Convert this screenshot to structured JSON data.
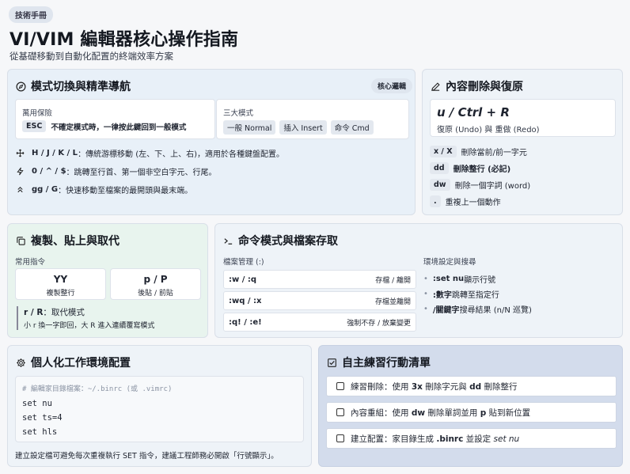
{
  "header": {
    "tag": "技術手冊",
    "title": "VI/VIM 編輯器核心操作指南",
    "subtitle": "從基礎移動到自動化配置的終端效率方案"
  },
  "nav": {
    "title": "模式切換與精準導航",
    "badge": "核心邏輯",
    "safe_label": "萬用保險",
    "safe_key": "ESC",
    "safe_desc": "不確定模式時，一律按此鍵回到一般模式",
    "modes_label": "三大模式",
    "modes": [
      "一般 Normal",
      "插入 Insert",
      "命令 Cmd"
    ],
    "items": [
      {
        "key": "H / J / K / L",
        "desc": "：傳統游標移動 (左、下、上、右)，適用於各種鍵盤配置。"
      },
      {
        "key": "0 / ^ / $",
        "desc": "：跳轉至行首、第一個非空白字元、行尾。"
      },
      {
        "key": "gg / G",
        "desc": "：快速移動至檔案的最開頭與最末端。"
      }
    ]
  },
  "delete": {
    "title": "內容刪除與復原",
    "undo_key": "u / Ctrl + R",
    "undo_desc": "復原 (Undo) 與 重做 (Redo)",
    "items": [
      {
        "key": "x / X",
        "desc": "刪除當前/前一字元",
        "bold": false
      },
      {
        "key": "dd",
        "desc": "刪除整行 (必記)",
        "bold": true
      },
      {
        "key": "dw",
        "desc": "刪除一個字詞 (word)",
        "bold": false
      },
      {
        "key": ".",
        "desc": "重複上一個動作",
        "bold": false
      }
    ]
  },
  "copy": {
    "title": "複製、貼上與取代",
    "label": "常用指令",
    "yy_key": "YY",
    "yy_desc": "複製整行",
    "p_key": "p / P",
    "p_desc": "後貼 / 前貼",
    "replace_key": "r / R",
    "replace_title": "：取代模式",
    "replace_desc": "小 r 換一字即回，大 R 進入連續覆寫模式"
  },
  "command": {
    "title": "命令模式與檔案存取",
    "file_label": "檔案管理 (:)",
    "rows": [
      {
        "cmd": ":w / :q",
        "desc": "存檔 / 離開"
      },
      {
        "cmd": ":wq / :x",
        "desc": "存檔並離開"
      },
      {
        "cmd": ":q! / :e!",
        "desc": "強制不存 / 放棄變更"
      }
    ],
    "env_label": "環境設定與搜尋",
    "env": [
      {
        "key": ":set nu",
        "desc": " 顯示行號"
      },
      {
        "key": ":數字",
        "desc": " 跳轉至指定行"
      },
      {
        "key": "/關鍵字",
        "desc": " 搜尋結果 (n/N 巡覽)"
      }
    ]
  },
  "config": {
    "title": "個人化工作環境配置",
    "comment": "# 編輯家目錄檔案：~/.binrc (或 .vimrc)",
    "lines": [
      "set nu",
      "set ts=4",
      "set hls"
    ],
    "note": "建立設定檔可避免每次重複執行 SET 指令，建議工程師務必開啟「行號顯示」。"
  },
  "tasks": {
    "title": "自主練習行動清單",
    "items": [
      {
        "pre": "練習刪除：使用 ",
        "k1": "3x",
        "mid": " 刪除字元與 ",
        "k2": "dd",
        "post": " 刪除整行"
      },
      {
        "pre": "內容重組：使用 ",
        "k1": "dw",
        "mid": " 刪除單詞並用 ",
        "k2": "p",
        "post": " 貼到新位置"
      },
      {
        "pre": "建立配置：家目錄生成 ",
        "k1": ".binrc",
        "mid": " 並設定 ",
        "k2": "set nu",
        "post": ""
      }
    ]
  },
  "colors": {
    "nav_bg": "#e8f0f8",
    "copy_bg": "#e8f4ee",
    "task_bg": "#d3dcec"
  }
}
